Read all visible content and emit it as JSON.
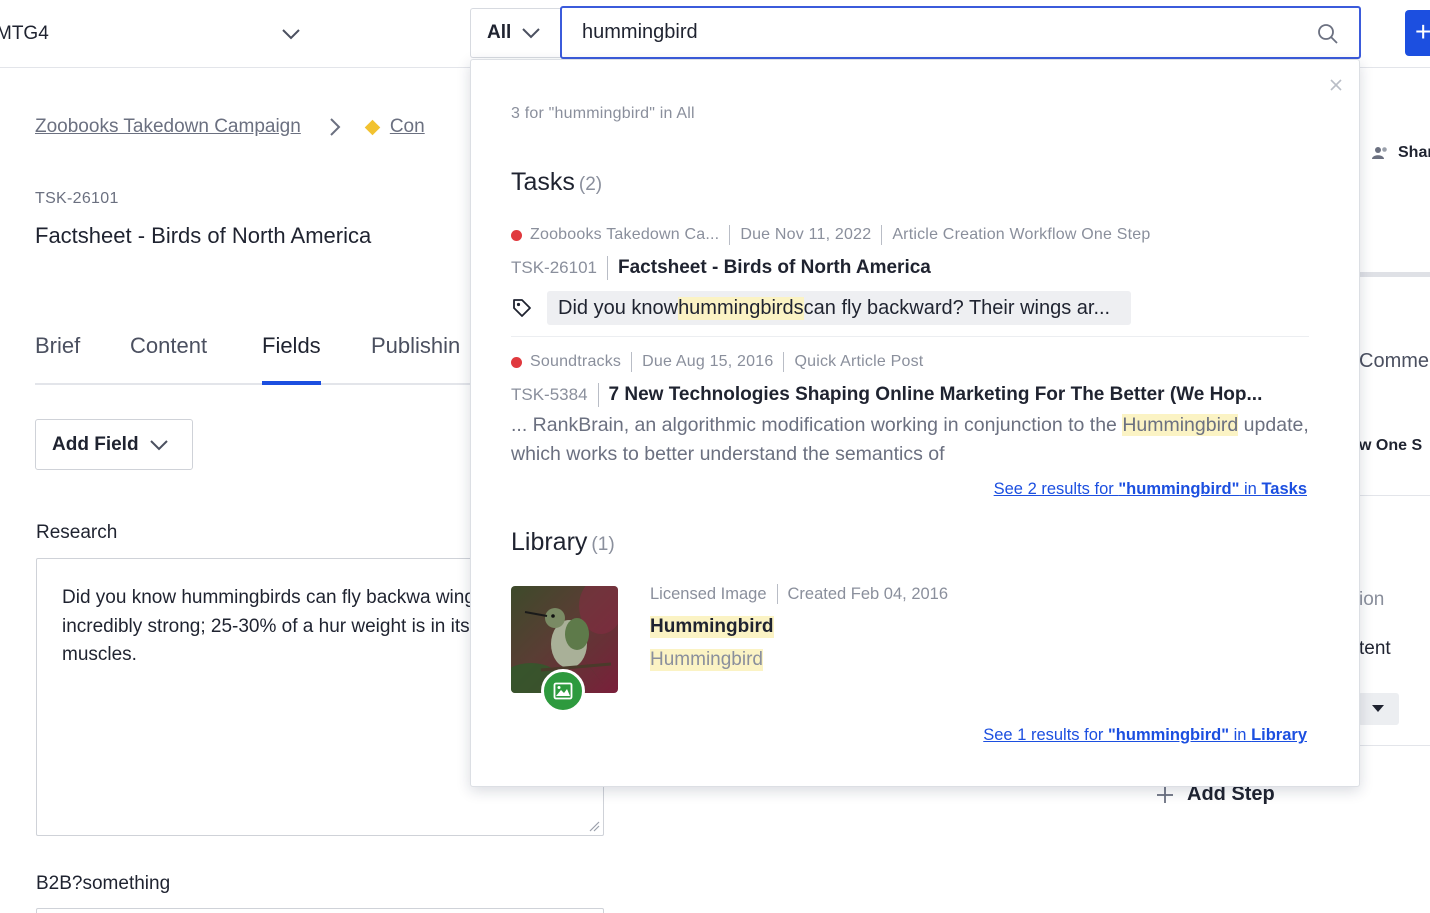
{
  "header": {
    "workspace_name": "MTG4",
    "scope_label": "All",
    "search_value": "hummingbird",
    "primary_button_label": "+"
  },
  "page": {
    "breadcrumb": {
      "campaign": "Zoobooks Takedown Campaign",
      "content": "Con"
    },
    "task_id": "TSK-26101",
    "task_title": "Factsheet - Birds of North America",
    "tabs": [
      "Brief",
      "Content",
      "Fields",
      "Publishin"
    ],
    "active_tab": "Fields",
    "add_field_label": "Add Field",
    "research_label": "Research",
    "research_text": "Did you know hummingbirds can fly backwa wings are incredibly strong; 25-30% of a hur weight is in its pectoral muscles.",
    "b2b_label": "B2B?something"
  },
  "right_panel": {
    "share_label": "Shar",
    "comments_label": "Comme",
    "workflow_label": "w One S",
    "option_1": "ion",
    "option_2": "tent",
    "add_step_label": "Add Step"
  },
  "dropdown": {
    "summary": "3 for \"hummingbird\" in All",
    "tasks": {
      "heading": "Tasks",
      "count": "(2)",
      "results": [
        {
          "campaign": "Zoobooks Takedown Ca...",
          "due": "Due Nov 11, 2022",
          "workflow": "Article Creation Workflow One Step",
          "task_id": "TSK-26101",
          "title": "Factsheet - Birds of North America",
          "snippet_before": "Did you know ",
          "snippet_match": "hummingbirds",
          "snippet_after": " can fly backward? Their wings ar..."
        },
        {
          "campaign": "Soundtracks",
          "due": "Due Aug 15, 2016",
          "workflow": "Quick Article Post",
          "task_id": "TSK-5384",
          "title": "7 New Technologies Shaping Online Marketing For The Better (We Hop...",
          "snippet_before": "... RankBrain, an algorithmic modification working in conjunction to the ",
          "snippet_match": "Hummingbird",
          "snippet_after": " update, which works to better understand the semantics of"
        }
      ],
      "see_all": {
        "prefix": "See 2 results for ",
        "query": "\"hummingbird\"",
        "middle": " in ",
        "scope": "Tasks"
      }
    },
    "library": {
      "heading": "Library",
      "count": "(1)",
      "results": [
        {
          "type": "Licensed Image",
          "created": "Created Feb 04, 2016",
          "title": "Hummingbird",
          "subtitle": "Hummingbird"
        }
      ],
      "see_all": {
        "prefix": "See 1 results for ",
        "query": "\"hummingbird\"",
        "middle": " in ",
        "scope": "Library"
      }
    }
  },
  "colors": {
    "accent": "#1c4fe0",
    "status_dot": "#e0393e",
    "highlight": "#fbf3c4",
    "badge_green": "#2e9a3e",
    "content_diamond": "#f2c230"
  },
  "icons": {
    "workspace_chevron": "chevron-down-icon",
    "scope_chevron": "chevron-down-icon",
    "search": "search-icon",
    "close": "close-icon",
    "tag": "tag-icon",
    "image_badge": "image-icon",
    "share": "users-icon",
    "add_step": "plus-icon"
  }
}
